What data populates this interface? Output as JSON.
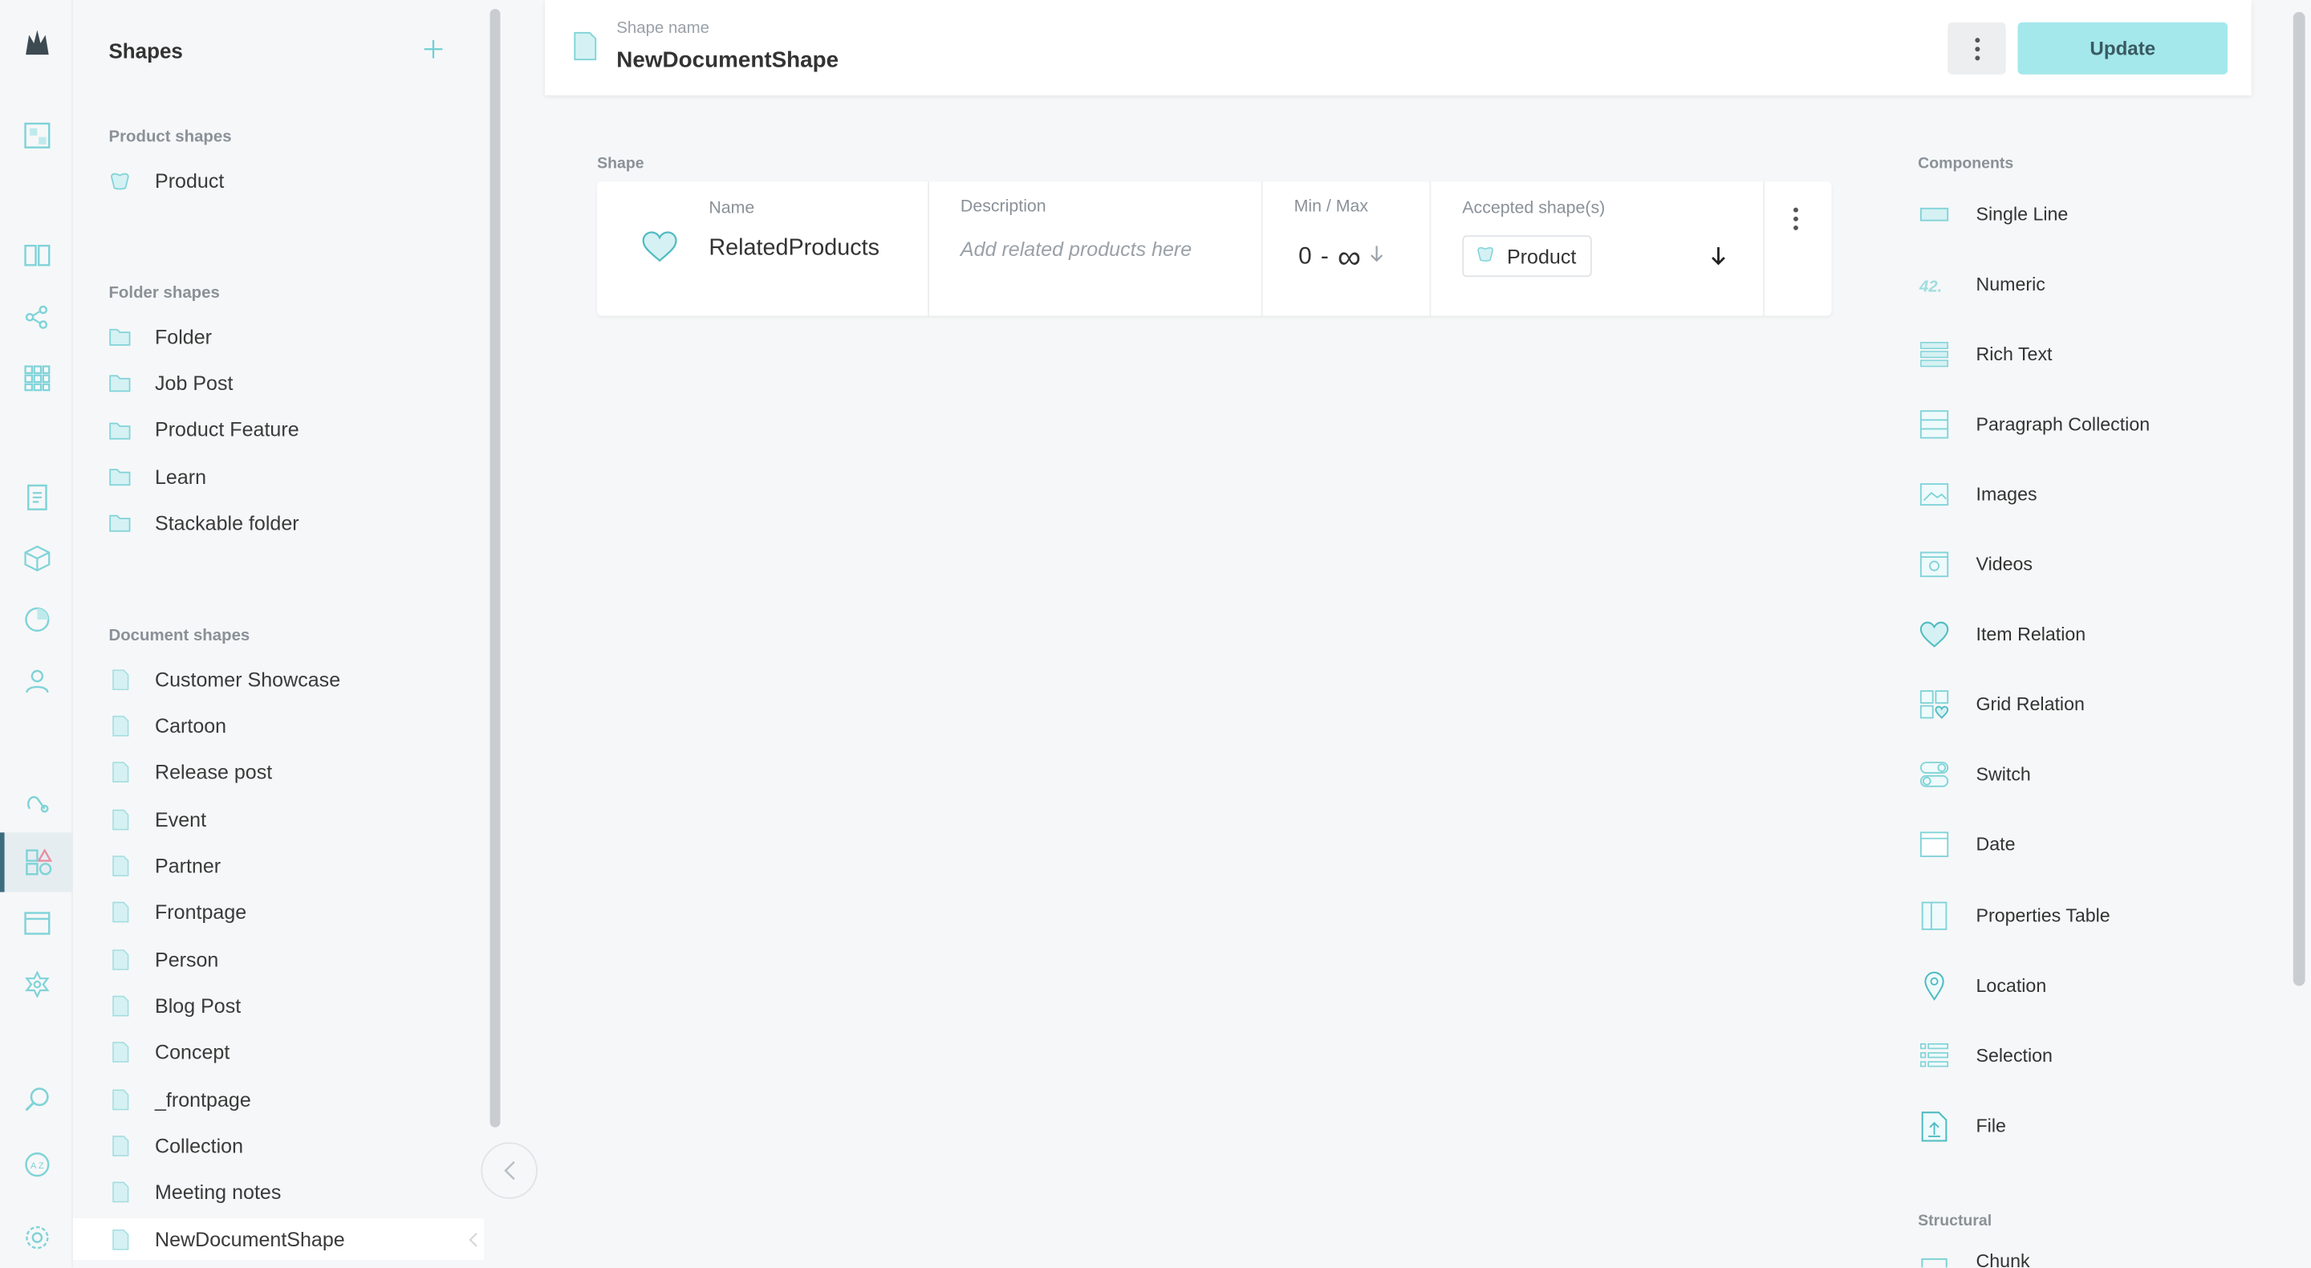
{
  "sidebar_rail": {
    "icons": [
      "logo-icon",
      "dashboard-icon",
      "catalogue-icon",
      "topics-icon",
      "grids-icon",
      "orders-icon",
      "products-icon",
      "stats-icon",
      "customers-icon",
      "webhooks-icon",
      "shapes-icon",
      "subscriptions-icon",
      "settings-network-icon",
      "search-icon",
      "translations-icon",
      "settings-icon"
    ]
  },
  "panel": {
    "title": "Shapes",
    "product_section": "Product shapes",
    "product_items": [
      "Product"
    ],
    "folder_section": "Folder shapes",
    "folder_items": [
      "Folder",
      "Job Post",
      "Product Feature",
      "Learn",
      "Stackable folder"
    ],
    "document_section": "Document shapes",
    "document_items": [
      "Customer Showcase",
      "Cartoon",
      "Release post",
      "Event",
      "Partner",
      "Frontpage",
      "Person",
      "Blog Post",
      "Concept",
      "_frontpage",
      "Collection",
      "Meeting notes",
      "NewDocumentShape"
    ]
  },
  "header": {
    "label": "Shape name",
    "name": "NewDocumentShape",
    "update_label": "Update"
  },
  "shape": {
    "section": "Shape",
    "name_label": "Name",
    "name_value": "RelatedProducts",
    "description_label": "Description",
    "description_placeholder": "Add related products here",
    "minmax_label": "Min / Max",
    "min": "0",
    "dash": "-",
    "max": "∞",
    "accepted_label": "Accepted shape(s)",
    "accepted_value": "Product"
  },
  "components": {
    "section": "Components",
    "items": [
      "Single Line",
      "Numeric",
      "Rich Text",
      "Paragraph Collection",
      "Images",
      "Videos",
      "Item Relation",
      "Grid Relation",
      "Switch",
      "Date",
      "Properties Table",
      "Location",
      "Selection",
      "File"
    ],
    "structural_section": "Structural",
    "structural_first": "Chunk"
  },
  "colors": {
    "accent": "#6fcfd3",
    "update_bg": "#a4e8ec"
  }
}
